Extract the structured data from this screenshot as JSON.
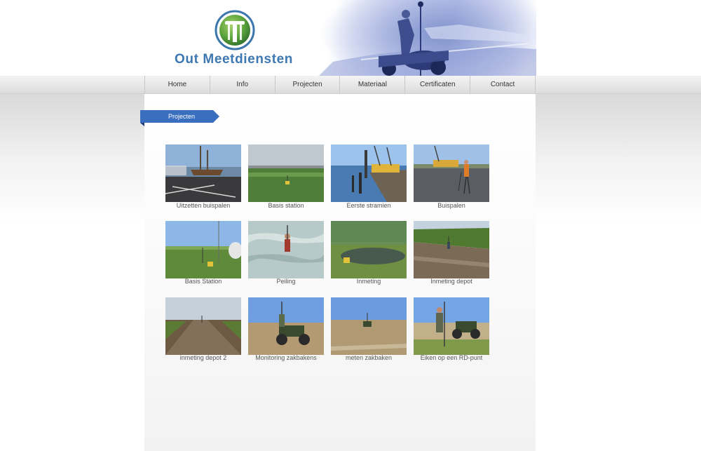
{
  "brand": {
    "name": "Out Meetdiensten",
    "logo_icon": "surveyor-tripod-logo-icon",
    "color": "#3e78b2"
  },
  "nav": {
    "items": [
      {
        "label": "Home"
      },
      {
        "label": "Info"
      },
      {
        "label": "Projecten"
      },
      {
        "label": "Materiaal"
      },
      {
        "label": "Certificaten"
      },
      {
        "label": "Contact"
      }
    ]
  },
  "section": {
    "title": "Projecten",
    "tab_color": "#3a6fbf"
  },
  "projects": [
    {
      "label": "Uitzetten buispalen"
    },
    {
      "label": "Basis station"
    },
    {
      "label": "Eerste stramien"
    },
    {
      "label": "Buispalen"
    },
    {
      "label": "Basis Station"
    },
    {
      "label": "Peiling"
    },
    {
      "label": "Inmeting"
    },
    {
      "label": "Inmeting depot"
    },
    {
      "label": "inmeting depot 2"
    },
    {
      "label": "Monitoring zakbakens"
    },
    {
      "label": "meten zakbaken"
    },
    {
      "label": "Eiken op een RD-punt"
    }
  ]
}
